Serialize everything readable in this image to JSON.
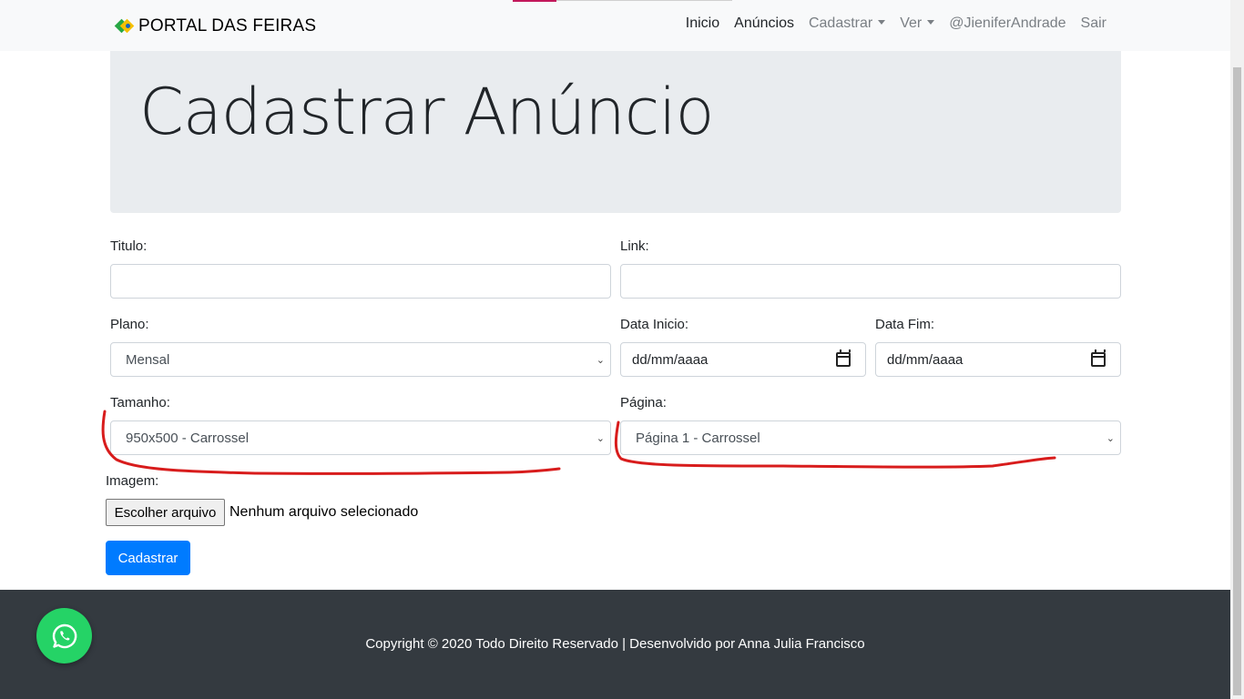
{
  "navbar": {
    "brand": "PORTAL DAS FEIRAS",
    "links": {
      "inicio": "Inicio",
      "anuncios": "Anúncios",
      "cadastrar": "Cadastrar",
      "ver": "Ver",
      "user": "@JieniferAndrade",
      "sair": "Sair"
    }
  },
  "page": {
    "title": "Cadastrar Anúncio"
  },
  "form": {
    "titulo_label": "Titulo:",
    "titulo_value": "",
    "link_label": "Link:",
    "link_value": "",
    "plano_label": "Plano:",
    "plano_value": "Mensal",
    "data_inicio_label": "Data Inicio:",
    "data_inicio_value": "dd/mm/aaaa",
    "data_fim_label": "Data Fim:",
    "data_fim_value": "dd/mm/aaaa",
    "tamanho_label": "Tamanho:",
    "tamanho_value": "950x500 - Carrossel",
    "pagina_label": "Página:",
    "pagina_value": "Página 1 - Carrossel",
    "imagem_label": "Imagem:",
    "file_button": "Escolher arquivo",
    "file_status": "Nenhum arquivo selecionado",
    "submit": "Cadastrar"
  },
  "footer": {
    "text": "Copyright © 2020 Todo Direito Reservado | Desenvolvido por Anna Julia Francisco"
  },
  "colors": {
    "primary": "#007bff",
    "footer_bg": "#343a40",
    "jumbotron_bg": "#e9ecef",
    "whatsapp": "#25d366",
    "annotation": "#d81c1c"
  },
  "icons": [
    "brazil-logo-icon",
    "caret-down-icon",
    "calendar-icon",
    "chevron-down-icon",
    "whatsapp-icon"
  ]
}
